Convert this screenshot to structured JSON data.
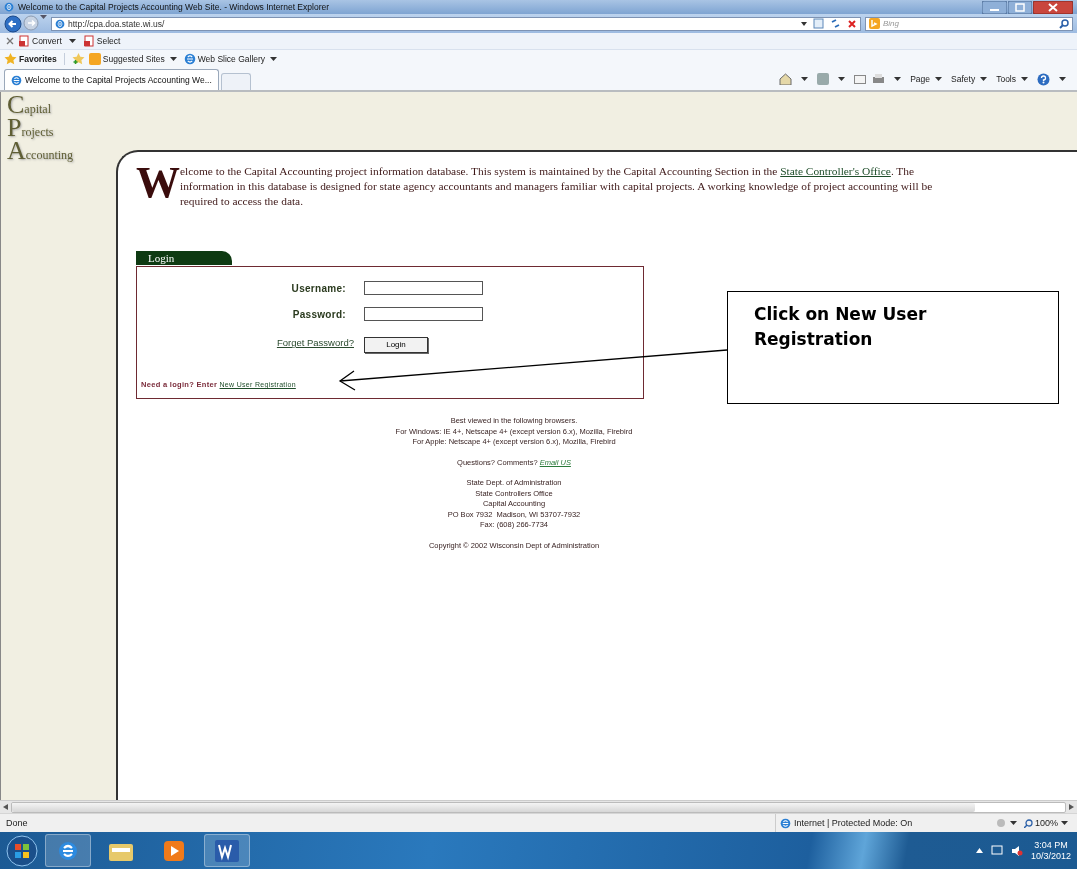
{
  "window": {
    "title": "Welcome to the Capital Projects Accounting Web Site. - Windows Internet Explorer"
  },
  "address_bar": {
    "url": "http://cpa.doa.state.wi.us/",
    "search_placeholder": "Bing"
  },
  "command_bar": [
    {
      "label": "Convert",
      "dropdown": true
    },
    {
      "label": "Select",
      "dropdown": false
    }
  ],
  "favorites_bar": {
    "title": "Favorites",
    "items": [
      {
        "label": "Suggested Sites"
      },
      {
        "label": "Web Slice Gallery"
      }
    ]
  },
  "tabs": [
    {
      "label": "Welcome to the Capital Projects Accounting We...",
      "selected": true
    }
  ],
  "toolbar": [
    {
      "label": "Page"
    },
    {
      "label": "Safety"
    },
    {
      "label": "Tools"
    }
  ],
  "page": {
    "logo": [
      {
        "initial": "C",
        "rest": "apital"
      },
      {
        "initial": "P",
        "rest": "rojects"
      },
      {
        "initial": "A",
        "rest": "ccounting"
      }
    ],
    "intro": {
      "initial": "W",
      "before": "elcome to the Capital Accounting project information database. This system is maintained by the Capital Accounting Section in the ",
      "link": "State Controller's Office",
      "after": ". The information in this database is designed for state agency accountants and managers familiar with capital projects. A working knowledge of project accounting will be required to access the data."
    },
    "login": {
      "title": "Login",
      "fields": [
        {
          "label": "Username:"
        },
        {
          "label": "Password:"
        }
      ],
      "forgot_link": "Forget Password?",
      "button": "Login",
      "register_prompt": "Need a login? Enter",
      "register_link": "New User Registration"
    },
    "footer": {
      "browsers": [
        "Best viewed in the following browsers.",
        "For Windows: IE 4+, Netscape 4+ (except version 6.x), Mozilla, Firebird",
        "For Apple: Netscape 4+ (except version 6.x), Mozilla, Firebird"
      ],
      "questions": "Questions? Comments?",
      "email_link": "Email US",
      "address": [
        "State Dept. of Administration",
        "State Controllers Office",
        "Capital Accounting",
        "PO Box 7932  Madison, WI 53707-7932",
        "Fax: (608) 266-7734"
      ],
      "copyright": "Copyright © 2002 Wisconsin Dept of Administration"
    }
  },
  "status_bar": {
    "text": "Done",
    "zone": "Internet | Protected Mode: On",
    "zoom": "100%"
  },
  "taskbar": {
    "time": "3:04 PM",
    "date": "10/3/2012"
  },
  "callout": {
    "text": "Click on New User Registration"
  }
}
